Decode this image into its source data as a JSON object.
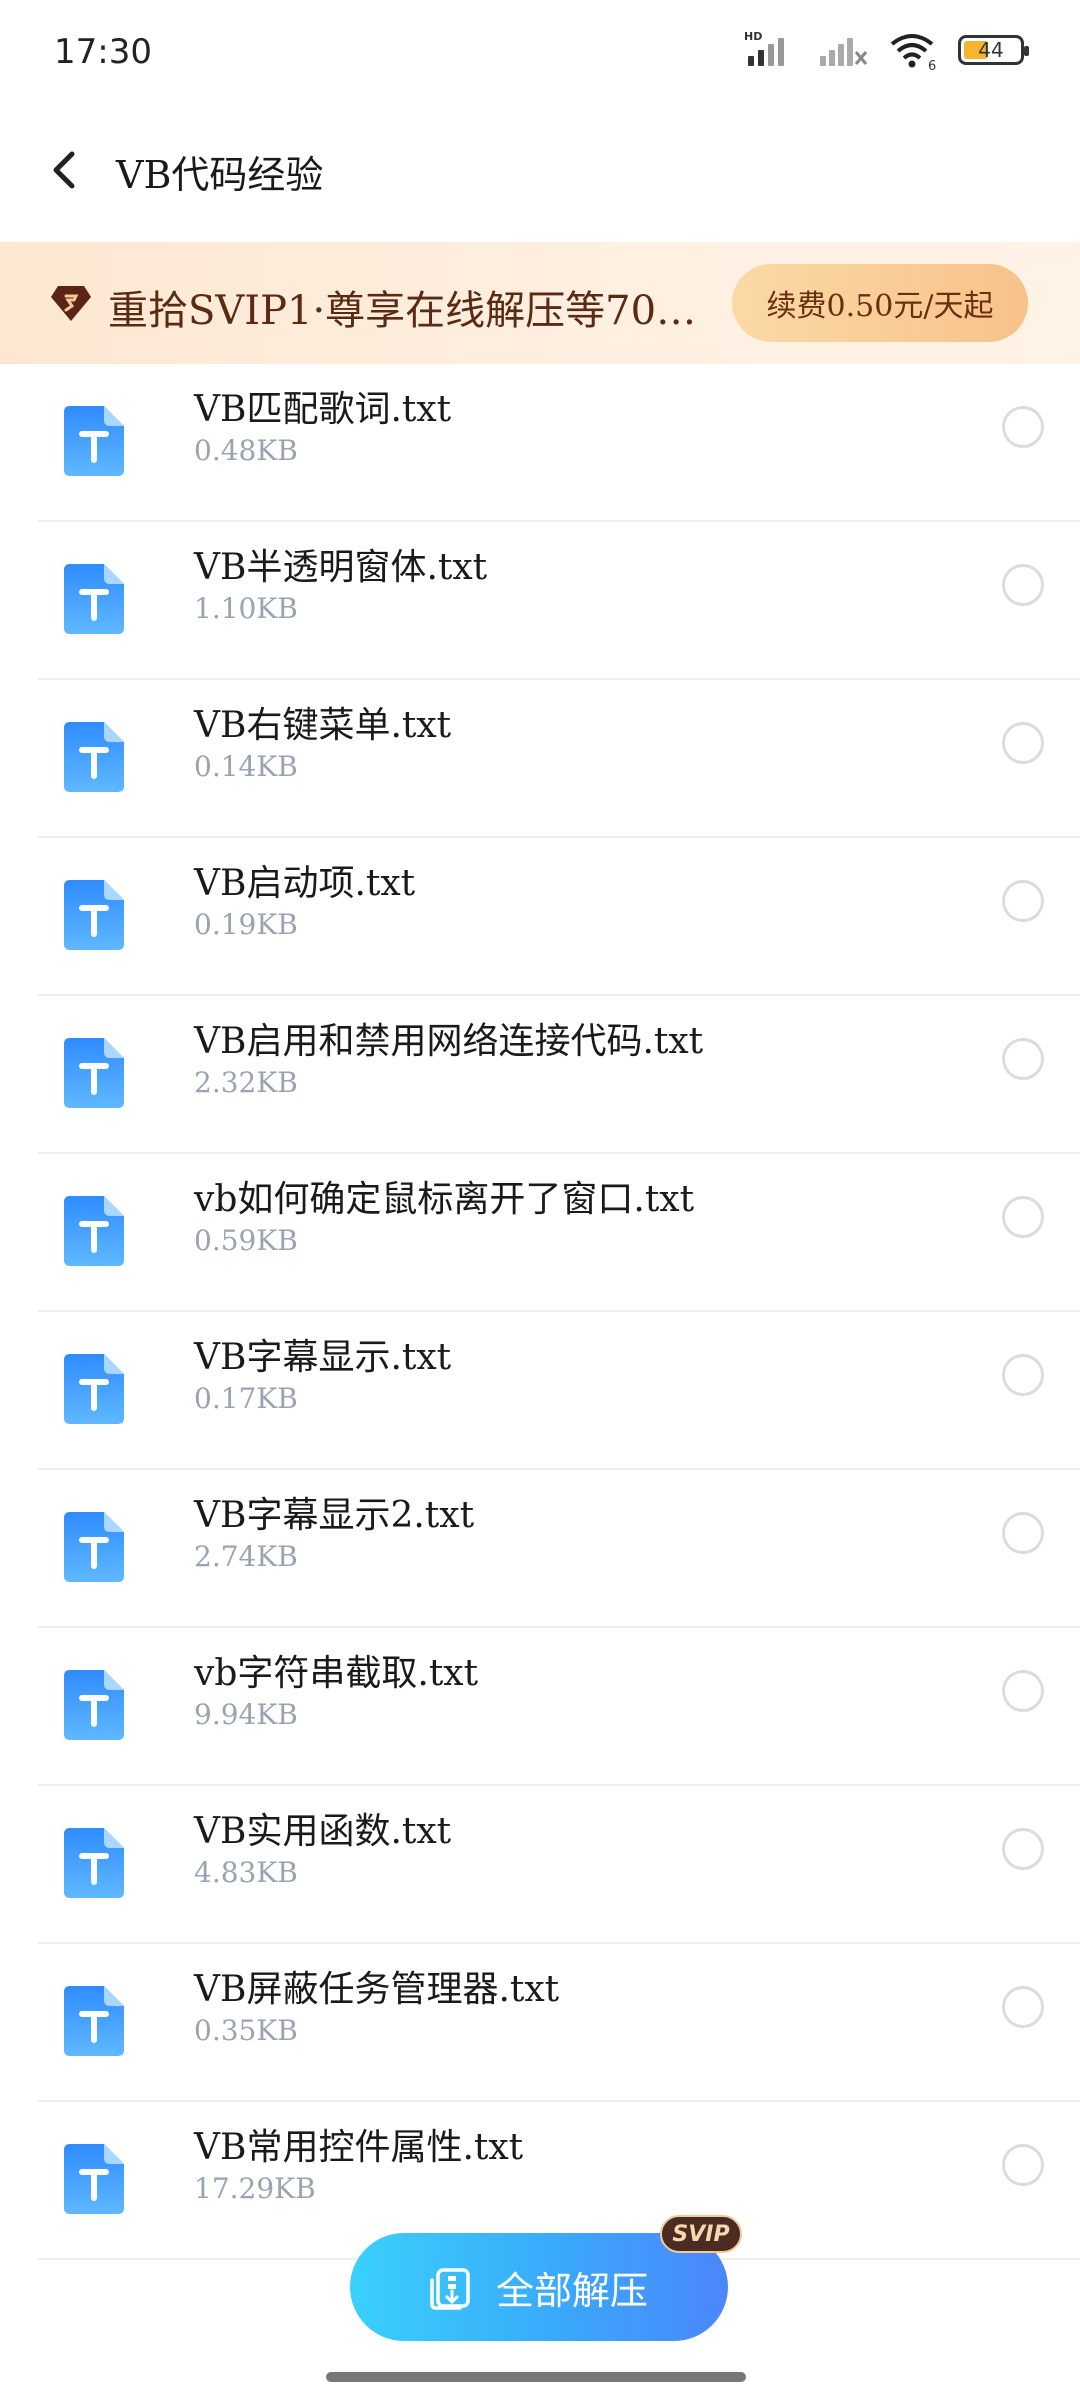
{
  "status": {
    "time": "17:30",
    "battery": "44",
    "battery_level": 0.44,
    "hd_label": "HD",
    "wifi_label": "6"
  },
  "header": {
    "title": "VB代码经验",
    "back_icon": "chevron-left-icon"
  },
  "vip_banner": {
    "text": "重拾SVIP1·尊享在线解压等70+…",
    "renew_label": "续费0.50元/天起",
    "gem_icon": "svip-gem-icon"
  },
  "files": [
    {
      "name": "VB匹配歌词.txt",
      "size": "0.48KB"
    },
    {
      "name": "VB半透明窗体.txt",
      "size": "1.10KB"
    },
    {
      "name": "VB右键菜单.txt",
      "size": "0.14KB"
    },
    {
      "name": "VB启动项.txt",
      "size": "0.19KB"
    },
    {
      "name": "VB启用和禁用网络连接代码.txt",
      "size": "2.32KB"
    },
    {
      "name": "vb如何确定鼠标离开了窗口.txt",
      "size": "0.59KB"
    },
    {
      "name": "VB字幕显示.txt",
      "size": "0.17KB"
    },
    {
      "name": "VB字幕显示2.txt",
      "size": "2.74KB"
    },
    {
      "name": "vb字符串截取.txt",
      "size": "9.94KB"
    },
    {
      "name": "VB实用函数.txt",
      "size": "4.83KB"
    },
    {
      "name": "VB屏蔽任务管理器.txt",
      "size": "0.35KB"
    },
    {
      "name": "VB常用控件属性.txt",
      "size": "17.29KB"
    }
  ],
  "footer": {
    "extract_all_label": "全部解压",
    "svip_badge": "SVIP",
    "accent_color": "#3aa9fb"
  }
}
